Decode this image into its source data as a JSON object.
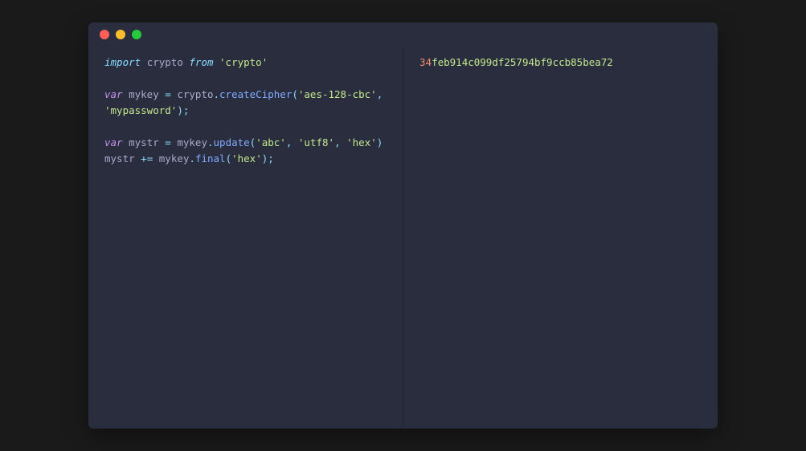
{
  "titlebar": {
    "buttons": [
      "close",
      "minimize",
      "zoom"
    ]
  },
  "code": {
    "line1": {
      "import": "import",
      "ident": "crypto",
      "from": "from",
      "module": "'crypto'"
    },
    "line2": {
      "var": "var",
      "name": "mykey",
      "eq": "=",
      "obj": "crypto",
      "dot": ".",
      "method": "createCipher",
      "lp": "(",
      "arg1": "'aes-128-cbc'",
      "comma": ",",
      "arg2": "'mypassword'",
      "rp": ")",
      "semi": ";"
    },
    "line3": {
      "var": "var",
      "name": "mystr",
      "eq": "=",
      "obj": "mykey",
      "dot": ".",
      "method": "update",
      "lp": "(",
      "arg1": "'abc'",
      "comma1": ",",
      "arg2": "'utf8'",
      "comma2": ",",
      "arg3": "'hex'",
      "rp": ")"
    },
    "line4": {
      "name": "mystr",
      "op": "+=",
      "obj": "mykey",
      "dot": ".",
      "method": "final",
      "lp": "(",
      "arg1": "'hex'",
      "rp": ")",
      "semi": ";"
    }
  },
  "output": {
    "num": "34",
    "rest": "feb914c099df25794bf9ccb85bea72"
  }
}
